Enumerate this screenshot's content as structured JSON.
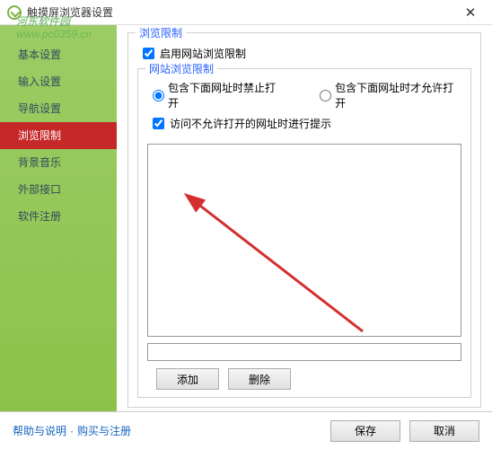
{
  "window": {
    "title": "触摸屏浏览器设置"
  },
  "watermark": {
    "line1": "河东软件园",
    "line2": "www.pc0359.cn"
  },
  "sidebar": {
    "items": [
      {
        "label": "基本设置"
      },
      {
        "label": "输入设置"
      },
      {
        "label": "导航设置"
      },
      {
        "label": "浏览限制",
        "selected": true
      },
      {
        "label": "背景音乐"
      },
      {
        "label": "外部接口"
      },
      {
        "label": "软件注册"
      }
    ]
  },
  "panel": {
    "groupTitle": "浏览限制",
    "enableLabel": "启用网站浏览限制",
    "enableChecked": true,
    "subGroupTitle": "网站浏览限制",
    "radio1": "包含下面网址时禁止打开",
    "radio2": "包含下面网址时才允许打开",
    "radioSelected": 1,
    "promptLabel": "访问不允许打开的网址时进行提示",
    "promptChecked": true,
    "list": "",
    "inputValue": "",
    "addBtn": "添加",
    "delBtn": "删除"
  },
  "footer": {
    "help": "帮助与说明",
    "buy": "购买与注册",
    "save": "保存",
    "cancel": "取消"
  }
}
